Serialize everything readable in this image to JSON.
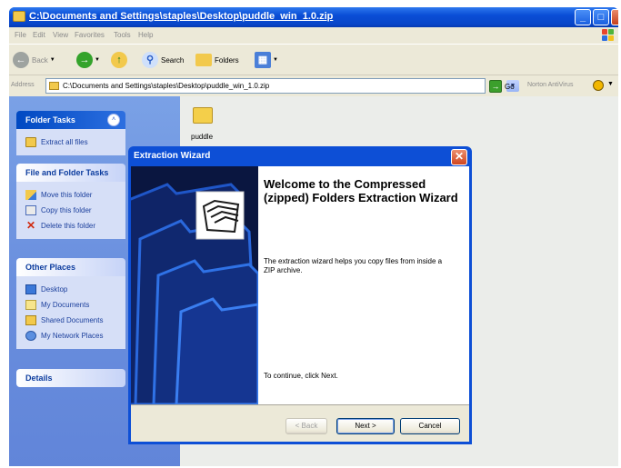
{
  "window": {
    "title": "C:\\Documents and Settings\\staples\\Desktop\\puddle_win_1.0.zip",
    "min_glyph": "_",
    "max_glyph": "□",
    "close_glyph": "X"
  },
  "menubar": [
    "File",
    "Edit",
    "View",
    "Favorites",
    "Tools",
    "Help"
  ],
  "toolbar": {
    "back_label": "Back",
    "search_label": "Search",
    "folders_label": "Folders",
    "back_icon": "back-arrow-icon",
    "forward_icon": "forward-arrow-icon",
    "up_icon": "up-folder-icon",
    "search_icon": "magnifier-icon",
    "folders_icon": "folders-icon",
    "views_icon": "views-icon"
  },
  "address": {
    "label": "Address",
    "value": "C:\\Documents and Settings\\staples\\Desktop\\puddle_win_1.0.zip",
    "go_label": "Go",
    "norton_label": "Norton AntiVirus"
  },
  "taskpane": {
    "folder_tasks": {
      "title": "Folder Tasks",
      "items": [
        {
          "label": "Extract all files",
          "icon": "extract-icon"
        }
      ]
    },
    "file_folder_tasks": {
      "title": "File and Folder Tasks",
      "items": [
        {
          "label": "Move this folder",
          "icon": "move-folder-icon"
        },
        {
          "label": "Copy this folder",
          "icon": "copy-folder-icon"
        },
        {
          "label": "Delete this folder",
          "icon": "delete-icon"
        }
      ]
    },
    "other_places": {
      "title": "Other Places",
      "items": [
        {
          "label": "Desktop",
          "icon": "desktop-icon"
        },
        {
          "label": "My Documents",
          "icon": "my-documents-icon"
        },
        {
          "label": "Shared Documents",
          "icon": "shared-documents-icon"
        },
        {
          "label": "My Network Places",
          "icon": "network-places-icon"
        }
      ]
    },
    "details": {
      "title": "Details"
    }
  },
  "content": {
    "items": [
      {
        "label": "puddle",
        "icon": "folder-icon"
      }
    ]
  },
  "wizard": {
    "title": "Extraction Wizard",
    "heading": "Welcome to the Compressed (zipped) Folders Extraction Wizard",
    "body": "The extraction wizard helps you copy files from inside a ZIP archive.",
    "continue_text": "To continue, click Next.",
    "back_button": "< Back",
    "next_button": "Next >",
    "cancel_button": "Cancel"
  },
  "colors": {
    "titlebar": "#0a4ed6",
    "taskpane": "#6a8fde",
    "dialog_side": "#0b1a49"
  }
}
